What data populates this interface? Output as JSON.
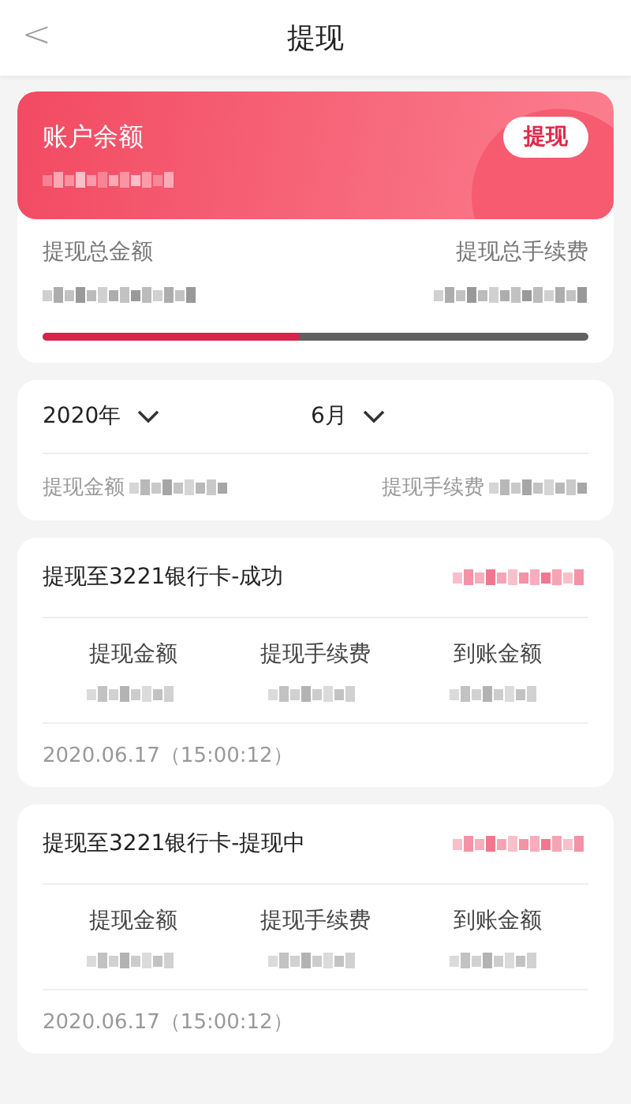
{
  "header": {
    "back": "<",
    "title": "提现"
  },
  "balance": {
    "label": "账户余额",
    "action": "提现",
    "total_label": "提现总金额",
    "fee_label": "提现总手续费",
    "level": 0.47
  },
  "filter": {
    "year": "2020年",
    "month": "6月",
    "amount_label": "提现金额",
    "fee_label": "提现手续费"
  },
  "records": [
    {
      "title": "提现至3221银行卡-成功",
      "columns": [
        "提现金额",
        "提现手续费",
        "到账金额"
      ],
      "date": "2020.06.17（15:00:12）"
    },
    {
      "title": "提现至3221银行卡-提现中",
      "columns": [
        "提现金额",
        "提现手续费",
        "到账金额"
      ],
      "date": "2020.06.17（15:00:12）"
    }
  ]
}
